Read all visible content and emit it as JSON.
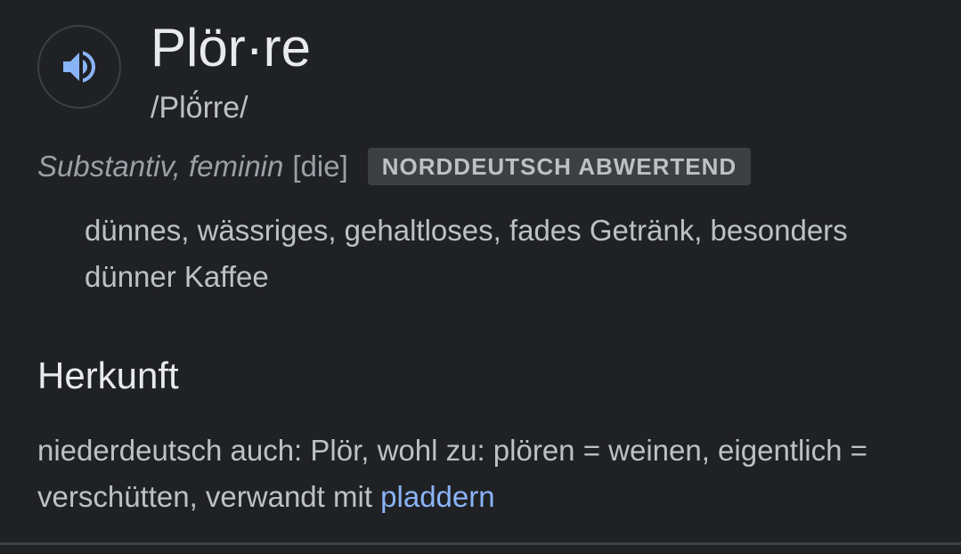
{
  "entry": {
    "headword": "Plör·re",
    "phonetic": "/Plö́rre/",
    "part_of_speech": "Substantiv, feminin",
    "gender_article": "[die]",
    "usage_label": "NORDDEUTSCH ABWERTEND",
    "definition": "dünnes, wässriges, gehaltloses, fades Getränk, besonders dünner Kaffee",
    "audio_icon": "speaker-icon"
  },
  "herkunft": {
    "title": "Herkunft",
    "text": "niederdeutsch auch: Plör, wohl zu: plören = weinen, eigentlich = verschütten, verwandt mit ",
    "link_text": "pladdern"
  },
  "colors": {
    "background": "#202124",
    "primary_text": "#e8eaed",
    "secondary_text": "#bdc1c6",
    "muted_text": "#9aa0a6",
    "badge_bg": "#3c4043",
    "link": "#8ab4f8",
    "speaker_icon": "#8ab4f8"
  }
}
